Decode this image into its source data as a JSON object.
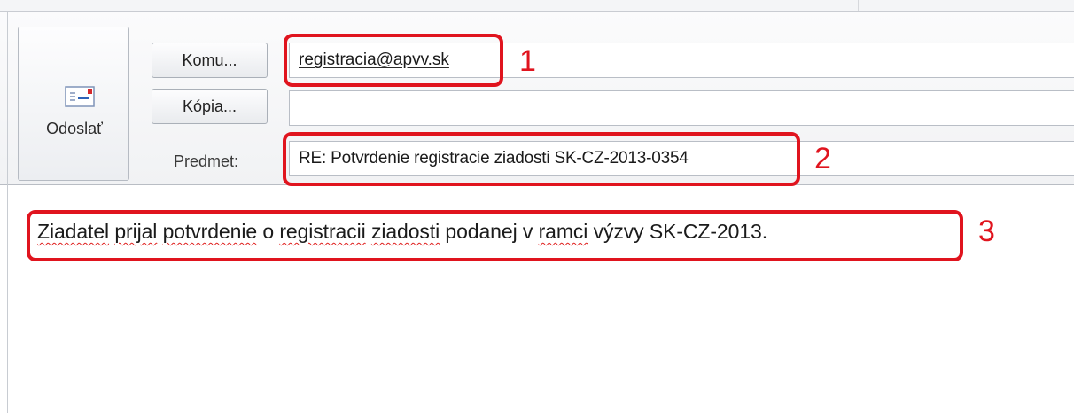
{
  "compose": {
    "send_label": "Odoslať",
    "to_button_label": "Komu...",
    "cc_button_label": "Kópia...",
    "subject_label": "Predmet:",
    "to_value": "registracia@apvv.sk",
    "cc_value": "",
    "subject_value": "RE: Potvrdenie registracie ziadosti SK-CZ-2013-0354"
  },
  "body": {
    "segments": [
      {
        "text": "Ziadatel",
        "spell": true
      },
      {
        "text": " ",
        "spell": false
      },
      {
        "text": "prijal",
        "spell": true
      },
      {
        "text": " ",
        "spell": false
      },
      {
        "text": "potvrdenie",
        "spell": true
      },
      {
        "text": " o ",
        "spell": false
      },
      {
        "text": "registracii",
        "spell": true
      },
      {
        "text": " ",
        "spell": false
      },
      {
        "text": "ziadosti",
        "spell": true
      },
      {
        "text": " podanej v ",
        "spell": false
      },
      {
        "text": "ramci",
        "spell": true
      },
      {
        "text": " výzvy SK-CZ-2013.",
        "spell": false
      }
    ]
  },
  "annotations": {
    "to_number": "1",
    "subject_number": "2",
    "body_number": "3",
    "highlight_color": "#e0141e"
  },
  "icons": {
    "send": "envelope-send-icon"
  }
}
